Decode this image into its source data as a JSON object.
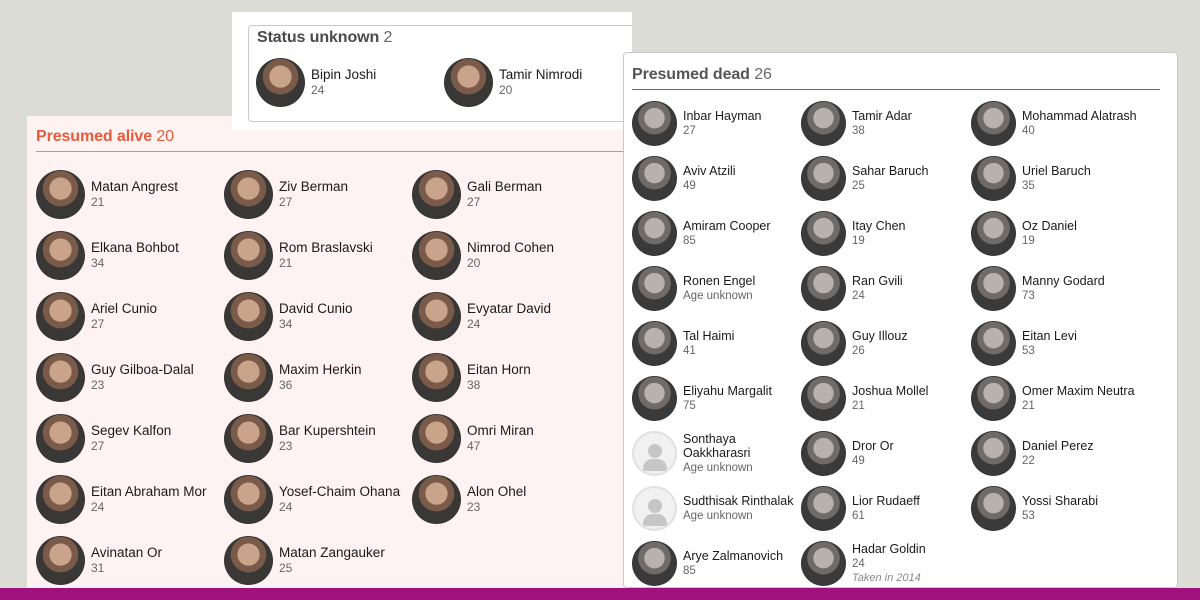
{
  "status_unknown": {
    "title": "Status unknown",
    "count": "2",
    "people": [
      {
        "name": "Bipin Joshi",
        "age": "24"
      },
      {
        "name": "Tamir Nimrodi",
        "age": "20"
      }
    ]
  },
  "presumed_alive": {
    "title": "Presumed alive",
    "count": "20",
    "people": [
      {
        "name": "Matan Angrest",
        "age": "21"
      },
      {
        "name": "Ziv Berman",
        "age": "27"
      },
      {
        "name": "Gali Berman",
        "age": "27"
      },
      {
        "name": "Elkana Bohbot",
        "age": "34"
      },
      {
        "name": "Rom Braslavski",
        "age": "21"
      },
      {
        "name": "Nimrod Cohen",
        "age": "20"
      },
      {
        "name": "Ariel Cunio",
        "age": "27"
      },
      {
        "name": "David Cunio",
        "age": "34"
      },
      {
        "name": "Evyatar David",
        "age": "24"
      },
      {
        "name": "Guy Gilboa-Dalal",
        "age": "23"
      },
      {
        "name": "Maxim Herkin",
        "age": "36"
      },
      {
        "name": "Eitan Horn",
        "age": "38"
      },
      {
        "name": "Segev Kalfon",
        "age": "27"
      },
      {
        "name": "Bar Kupershtein",
        "age": "23"
      },
      {
        "name": "Omri Miran",
        "age": "47"
      },
      {
        "name": "Eitan Abraham Mor",
        "age": "24"
      },
      {
        "name": "Yosef-Chaim Ohana",
        "age": "24"
      },
      {
        "name": "Alon Ohel",
        "age": "23"
      },
      {
        "name": "Avinatan Or",
        "age": "31"
      },
      {
        "name": "Matan Zangauker",
        "age": "25"
      }
    ]
  },
  "presumed_dead": {
    "title": "Presumed dead",
    "count": "26",
    "people": [
      {
        "name": "Inbar Hayman",
        "age": "27"
      },
      {
        "name": "Tamir Adar",
        "age": "38"
      },
      {
        "name": "Mohammad Alatrash",
        "age": "40"
      },
      {
        "name": "Aviv Atzili",
        "age": "49"
      },
      {
        "name": "Sahar Baruch",
        "age": "25"
      },
      {
        "name": "Uriel Baruch",
        "age": "35"
      },
      {
        "name": "Amiram Cooper",
        "age": "85"
      },
      {
        "name": "Itay Chen",
        "age": "19"
      },
      {
        "name": "Oz Daniel",
        "age": "19"
      },
      {
        "name": "Ronen Engel",
        "age": "Age unknown"
      },
      {
        "name": "Ran Gvili",
        "age": "24"
      },
      {
        "name": "Manny Godard",
        "age": "73"
      },
      {
        "name": "Tal Haimi",
        "age": "41"
      },
      {
        "name": "Guy Illouz",
        "age": "26"
      },
      {
        "name": "Eitan Levi",
        "age": "53"
      },
      {
        "name": "Eliyahu Margalit",
        "age": "75"
      },
      {
        "name": "Joshua Mollel",
        "age": "21"
      },
      {
        "name": "Omer Maxim Neutra",
        "age": "21"
      },
      {
        "name": "Sonthaya Oakkharasri",
        "age": "Age unknown",
        "placeholder": true
      },
      {
        "name": "Dror Or",
        "age": "49"
      },
      {
        "name": "Daniel Perez",
        "age": "22"
      },
      {
        "name": "Sudthisak Rinthalak",
        "age": "Age unknown",
        "placeholder": true
      },
      {
        "name": "Lior Rudaeff",
        "age": "61"
      },
      {
        "name": "Yossi Sharabi",
        "age": "53"
      },
      {
        "name": "Arye Zalmanovich",
        "age": "85"
      },
      {
        "name": "Hadar Goldin",
        "age": "24",
        "note": "Taken in 2014"
      }
    ]
  },
  "colors": {
    "alive_accent": "#e85a3c",
    "alive_bg": "#fef3f2",
    "bottom_bar": "#a0117e"
  }
}
